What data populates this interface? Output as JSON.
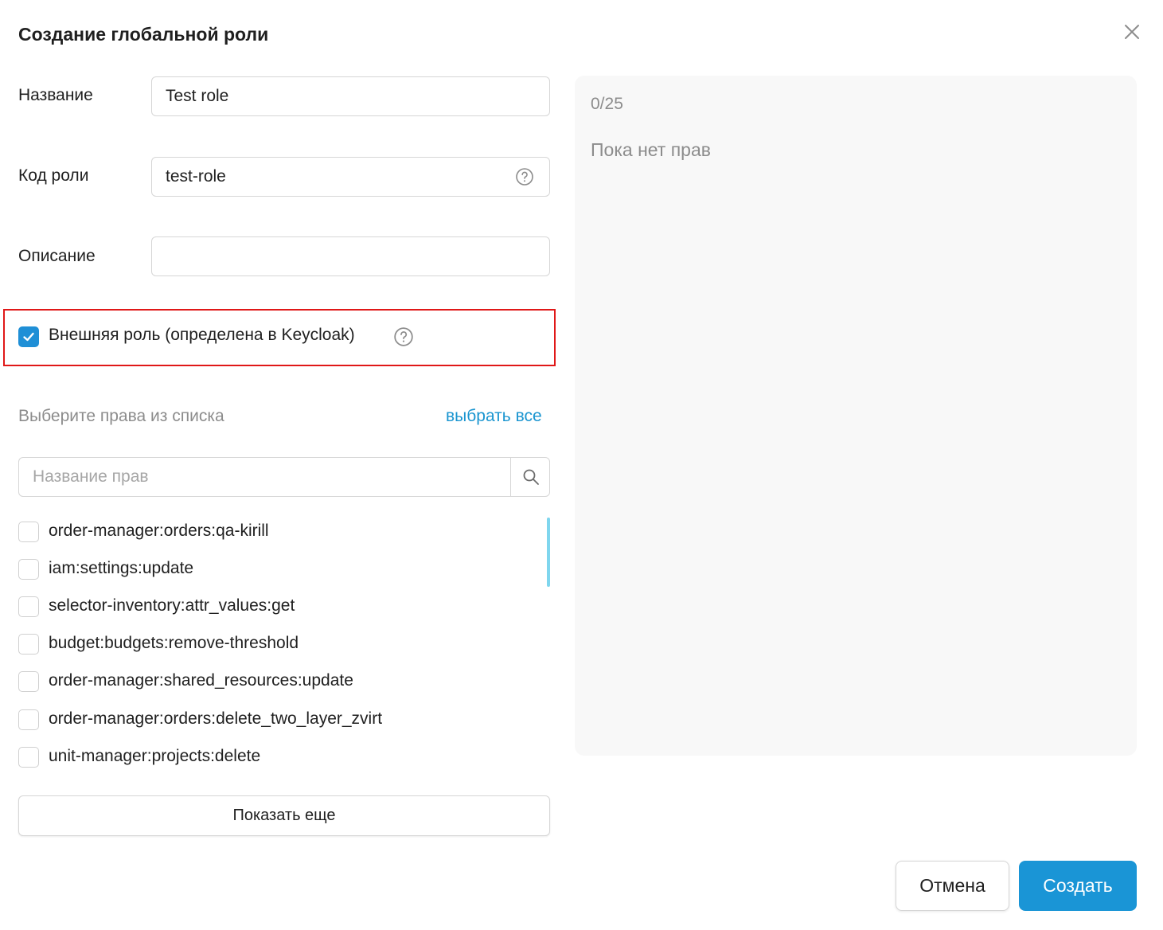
{
  "dialog": {
    "title": "Создание глобальной роли"
  },
  "form": {
    "name_label": "Название",
    "name_value": "Test role",
    "code_label": "Код роли",
    "code_value": "test-role",
    "description_label": "Описание",
    "description_value": "",
    "external_role_label": "Внешняя роль (определена в Keycloak)",
    "external_role_checked": true
  },
  "permissions": {
    "section_label": "Выберите права из списка",
    "select_all_label": "выбрать все",
    "search_placeholder": "Название прав",
    "items": [
      {
        "label": "order-manager:orders:qa-kirill",
        "checked": false
      },
      {
        "label": "iam:settings:update",
        "checked": false
      },
      {
        "label": "selector-inventory:attr_values:get",
        "checked": false
      },
      {
        "label": "budget:budgets:remove-threshold",
        "checked": false
      },
      {
        "label": "order-manager:shared_resources:update",
        "checked": false
      },
      {
        "label": "order-manager:orders:delete_two_layer_zvirt",
        "checked": false
      },
      {
        "label": "unit-manager:projects:delete",
        "checked": false
      }
    ],
    "show_more_label": "Показать еще"
  },
  "selected_panel": {
    "counter": "0/25",
    "empty_text": "Пока нет прав"
  },
  "footer": {
    "cancel_label": "Отмена",
    "create_label": "Создать"
  },
  "colors": {
    "accent": "#1a95d6",
    "highlight_border": "#e01818",
    "muted_text": "#8c8c8c"
  }
}
